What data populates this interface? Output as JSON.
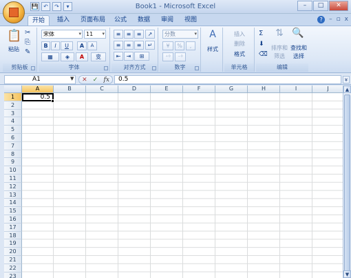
{
  "window": {
    "title": "Book1 - Microsoft Excel",
    "controls": [
      "–",
      "□",
      "✕"
    ]
  },
  "qat": [
    "💾",
    "↶",
    "↷",
    "▾"
  ],
  "tabs": [
    {
      "label": "开始",
      "active": true
    },
    {
      "label": "插入",
      "active": false
    },
    {
      "label": "页面布局",
      "active": false
    },
    {
      "label": "公式",
      "active": false
    },
    {
      "label": "数据",
      "active": false
    },
    {
      "label": "审阅",
      "active": false
    },
    {
      "label": "视图",
      "active": false
    }
  ],
  "tab_right": {
    "help": "?",
    "min": "–",
    "restore": "▫",
    "close": "x"
  },
  "ribbon": {
    "clipboard": {
      "paste": "粘贴",
      "label": "剪贴板"
    },
    "font": {
      "name": "宋体",
      "size": "11",
      "bold": "B",
      "italic": "I",
      "underline": "U",
      "grow": "A",
      "shrink": "A",
      "font_color": "A",
      "wen": "变",
      "label": "字体"
    },
    "alignment": {
      "label": "对齐方式"
    },
    "number": {
      "format": "分数",
      "percent": "%",
      "comma": ",",
      "label": "数字"
    },
    "styles": {
      "style": "样式"
    },
    "cells": {
      "insert": "插入",
      "delete": "删除",
      "format": "格式",
      "label": "单元格"
    },
    "editing": {
      "sigma": "Σ",
      "sort_filter_1": "排序和",
      "sort_filter_2": "筛选",
      "find_select_1": "查找和",
      "find_select_2": "选择",
      "label": "编辑"
    }
  },
  "formula_bar": {
    "name_box": "A1",
    "cancel": "✕",
    "enter": "✓",
    "fx": "fx",
    "content": "0.5",
    "expand": "¥"
  },
  "columns": [
    "A",
    "B",
    "C",
    "D",
    "E",
    "F",
    "G",
    "H",
    "I",
    "J"
  ],
  "rows": [
    "1",
    "2",
    "3",
    "4",
    "5",
    "6",
    "7",
    "8",
    "9",
    "10",
    "11",
    "12",
    "13",
    "14",
    "15",
    "16",
    "17",
    "18",
    "19",
    "20",
    "21",
    "22",
    "23"
  ],
  "cells": {
    "A1": "0.5"
  },
  "scroll": {
    "up": "▲",
    "down": "▼"
  }
}
